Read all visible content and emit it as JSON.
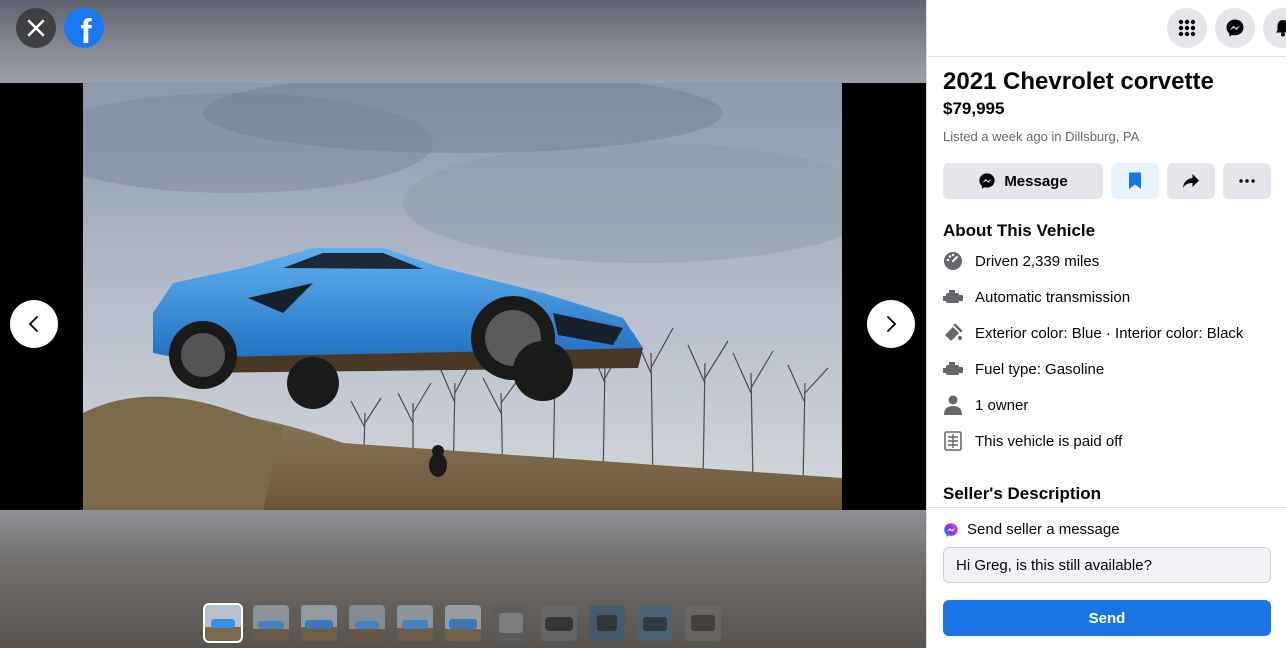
{
  "viewer": {
    "close_icon": "close-icon",
    "logo_letter": "f",
    "prev_icon": "chevron-left-icon",
    "next_icon": "chevron-right-icon",
    "thumbnail_count": 11,
    "active_thumbnail": 1
  },
  "topbar": {
    "icons": [
      "menu-grid-icon",
      "messenger-icon",
      "notifications-icon"
    ]
  },
  "listing": {
    "title": "2021 Chevrolet corvette",
    "price": "$79,995",
    "listed": "Listed a week ago in Dillsburg, PA",
    "message_button": "Message"
  },
  "about": {
    "heading": "About This Vehicle",
    "items": [
      {
        "icon": "gauge-icon",
        "text": "Driven 2,339 miles"
      },
      {
        "icon": "engine-icon",
        "text": "Automatic transmission"
      },
      {
        "icon": "paint-icon",
        "text": "Exterior color: Blue · Interior color: Black"
      },
      {
        "icon": "engine-icon",
        "text": "Fuel type: Gasoline"
      },
      {
        "icon": "person-icon",
        "text": "1 owner"
      },
      {
        "icon": "document-icon",
        "text": "This vehicle is paid off"
      }
    ]
  },
  "sellers_description": "Seller's Description",
  "footer": {
    "send_label": "Send seller a message",
    "message_value": "Hi Greg, is this still available?",
    "send_button": "Send"
  },
  "colors": {
    "accent": "#1b74e4",
    "car": "#3a8fe0"
  }
}
